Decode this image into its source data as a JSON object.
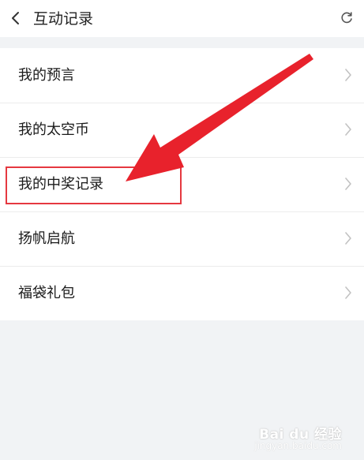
{
  "header": {
    "title": "互动记录",
    "back_icon": "back-icon",
    "refresh_icon": "refresh-icon"
  },
  "list": {
    "items": [
      {
        "label": "我的预言"
      },
      {
        "label": "我的太空币"
      },
      {
        "label": "我的中奖记录"
      },
      {
        "label": "扬帆启航"
      },
      {
        "label": "福袋礼包"
      }
    ]
  },
  "annotation": {
    "color": "#e8222c",
    "highlighted_item": "我的中奖记录"
  },
  "watermark": {
    "text": "Bai du 经验",
    "url": "jingyan.baidu.com"
  }
}
